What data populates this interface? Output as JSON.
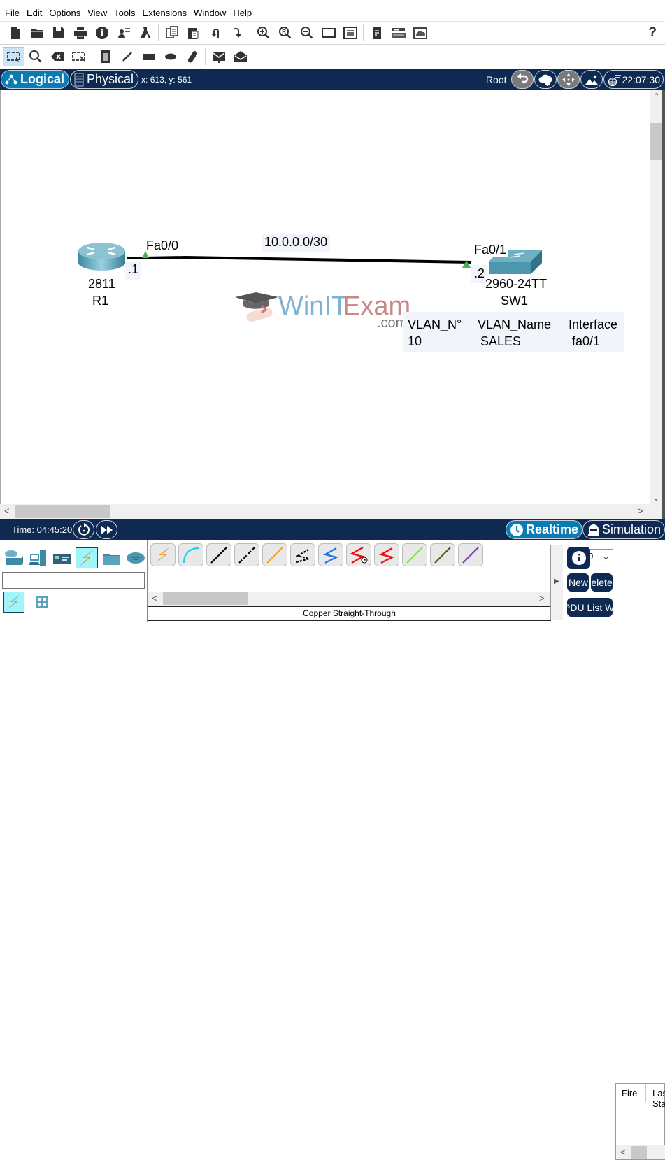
{
  "menu": [
    "File",
    "Edit",
    "Options",
    "View",
    "Tools",
    "Extensions",
    "Window",
    "Help"
  ],
  "menu_mnemonic": [
    "F",
    "E",
    "O",
    "V",
    "T",
    "x",
    "W",
    "H"
  ],
  "toolbar_main": {
    "icons": [
      "new-file",
      "open-folder",
      "save",
      "print",
      "activity-wizard-info",
      "network-information",
      "activity-flask",
      "copy",
      "paste",
      "undo",
      "redo",
      "zoom-in",
      "zoom-reset",
      "zoom-out",
      "drawing-palette",
      "custom-device-dialog",
      "viewport",
      "device-list",
      "cloud-window"
    ],
    "help_label": "?"
  },
  "toolbar_tools": {
    "icons": [
      "select",
      "inspect",
      "delete",
      "resize-shape",
      "place-note",
      "draw-line",
      "draw-rectangle",
      "draw-ellipse",
      "draw-freeform",
      "add-simple-pdu",
      "add-complex-pdu"
    ],
    "active": "select"
  },
  "navbar": {
    "logical_label": "Logical",
    "physical_label": "Physical",
    "coords": "x: 613, y: 561",
    "root_label": "Root",
    "clock": "22:07:30"
  },
  "topology": {
    "link_label": "10.0.0.0/30",
    "devices": [
      {
        "model": "2811",
        "name": "R1",
        "type": "router",
        "port": "Fa0/0",
        "ip_suffix": ".1"
      },
      {
        "model": "2960-24TT",
        "name": "SW1",
        "type": "switch",
        "port": "Fa0/1",
        "ip_suffix": ".2"
      }
    ],
    "note": {
      "headers": [
        "VLAN_N°",
        "VLAN_Name",
        "Interface"
      ],
      "row": [
        "10",
        "SALES",
        "fa0/1"
      ]
    },
    "watermark": {
      "part1": "WinIT",
      "part2": "Exam",
      "suffix": ".com"
    }
  },
  "statusbar": {
    "time": "Time: 04:45:20",
    "realtime_label": "Realtime",
    "simulation_label": "Simulation"
  },
  "device_panel": {
    "categories": [
      "network-devices",
      "end-devices",
      "components",
      "connections",
      "miscellaneous",
      "multiuser-connection"
    ],
    "selected_category": "connections",
    "subcategories": [
      "connections",
      "structured-cabling"
    ],
    "search_value": ""
  },
  "cables": {
    "items": [
      "automatic",
      "console",
      "copper-straight-through",
      "copper-cross-over",
      "fiber",
      "phone",
      "coaxial",
      "serial-dce",
      "serial-dte",
      "octal",
      "iot-custom",
      "usb"
    ],
    "selected_name": "Copper Straight-Through"
  },
  "pdu_panel": {
    "scenario_value": "0",
    "new_label": "New",
    "delete_label": "Delete",
    "pdu_list_label": "PDU List Window",
    "columns": [
      "Fire",
      "Last Status"
    ]
  },
  "colors": {
    "navbar_bg": "#0f2a52",
    "active_pill": "#0a7cb3",
    "link": "#000000",
    "port_up": "#4caf50",
    "note_bg": "#f2f4fb"
  }
}
